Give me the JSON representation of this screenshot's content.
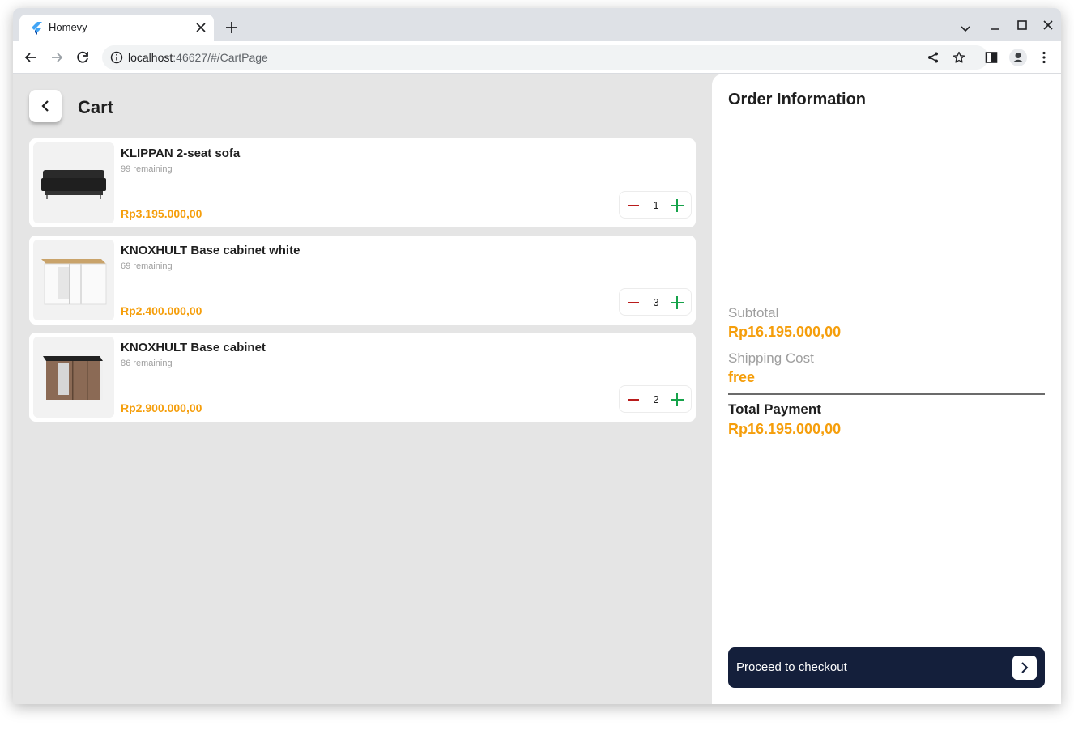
{
  "browser": {
    "tab_title": "Homevy",
    "url_host": "localhost",
    "url_path": ":46627/#/CartPage"
  },
  "page": {
    "title": "Cart"
  },
  "cart": {
    "items": [
      {
        "name": "KLIPPAN 2-seat sofa",
        "remaining": "99 remaining",
        "price": "Rp3.195.000,00",
        "quantity": "1"
      },
      {
        "name": "KNOXHULT Base cabinet white",
        "remaining": "69 remaining",
        "price": "Rp2.400.000,00",
        "quantity": "3"
      },
      {
        "name": "KNOXHULT Base cabinet",
        "remaining": "86 remaining",
        "price": "Rp2.900.000,00",
        "quantity": "2"
      }
    ]
  },
  "order": {
    "title": "Order Information",
    "subtotal_label": "Subtotal",
    "subtotal_value": "Rp16.195.000,00",
    "shipping_label": "Shipping Cost",
    "shipping_value": "free",
    "total_label": "Total Payment",
    "total_value": "Rp16.195.000,00",
    "checkout_label": "Proceed to checkout"
  },
  "colors": {
    "accent_price": "#f59e0b",
    "checkout_bg": "#141f3b",
    "minus": "#b91c1c",
    "plus": "#16a34a"
  },
  "icons": [
    "flutter-favicon-icon",
    "close-icon",
    "plus-icon",
    "chevron-down-icon",
    "minimize-icon",
    "maximize-icon",
    "back-arrow-icon",
    "forward-arrow-icon",
    "reload-icon",
    "info-icon",
    "share-icon",
    "star-icon",
    "side-panel-icon",
    "profile-icon",
    "kebab-menu-icon",
    "chevron-left-icon",
    "minus-icon",
    "chevron-right-icon"
  ]
}
